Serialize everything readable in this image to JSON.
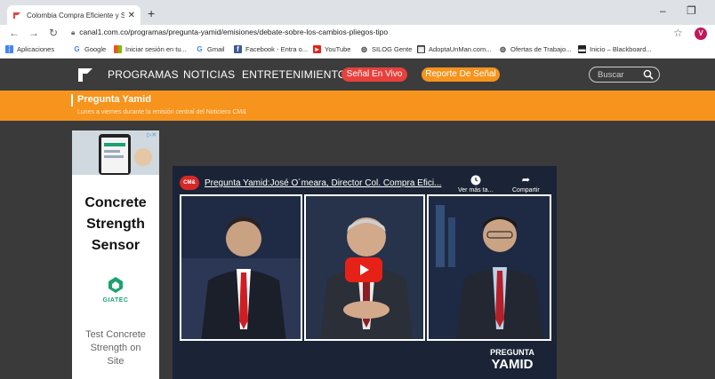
{
  "browser": {
    "tab_title": "Colombia Compra Eficiente y Se…",
    "url": "canal1.com.co/programas/pregunta-yamid/emisiones/debate-sobre-los-cambios-pliegos-tipo",
    "profile_initial": "V",
    "bookmarks": [
      {
        "label": "Aplicaciones",
        "icon": "apps-icon"
      },
      {
        "label": "Google",
        "icon": "google-icon"
      },
      {
        "label": "Iniciar sesión en tu...",
        "icon": "microsoft-icon"
      },
      {
        "label": "Gmail",
        "icon": "google-icon"
      },
      {
        "label": "Facebook - Entra o...",
        "icon": "facebook-icon"
      },
      {
        "label": "YouTube",
        "icon": "youtube-icon"
      },
      {
        "label": "SILOG Gente",
        "icon": "globe-icon"
      },
      {
        "label": "AdoptaUnMan.com...",
        "icon": "adopta-icon"
      },
      {
        "label": "Ofertas de Trabajo...",
        "icon": "globe-icon"
      },
      {
        "label": "Inicio – Blackboard...",
        "icon": "blackboard-icon"
      }
    ]
  },
  "site": {
    "nav": [
      "PROGRAMAS",
      "NOTICIAS",
      "ENTRETENIMIENTO"
    ],
    "live_label": "Señal En Vivo",
    "report_label": "Reporte De Señal",
    "search_placeholder": "Buscar",
    "colors": {
      "live": "#e8413c",
      "report": "#f7941d",
      "banner": "#f7941d"
    }
  },
  "banner": {
    "title": "Pregunta Yamid",
    "subtitle": "Lunes a viernes durante la emisión central del Noticiero CM&"
  },
  "ad": {
    "title_lines": [
      "Concrete",
      "Strength",
      "Sensor"
    ],
    "brand": "GIATEC",
    "cta_lines": [
      "Test Concrete",
      "Strength on",
      "Site"
    ]
  },
  "video": {
    "channel_badge": "CM&",
    "title": "Pregunta Yamid:José O´meara, Director Col. Compra Efici...",
    "watch_later": "Ver más ta...",
    "share": "Compartir",
    "brand_top": "PREGUNTA",
    "brand_bottom": "YAMID"
  }
}
